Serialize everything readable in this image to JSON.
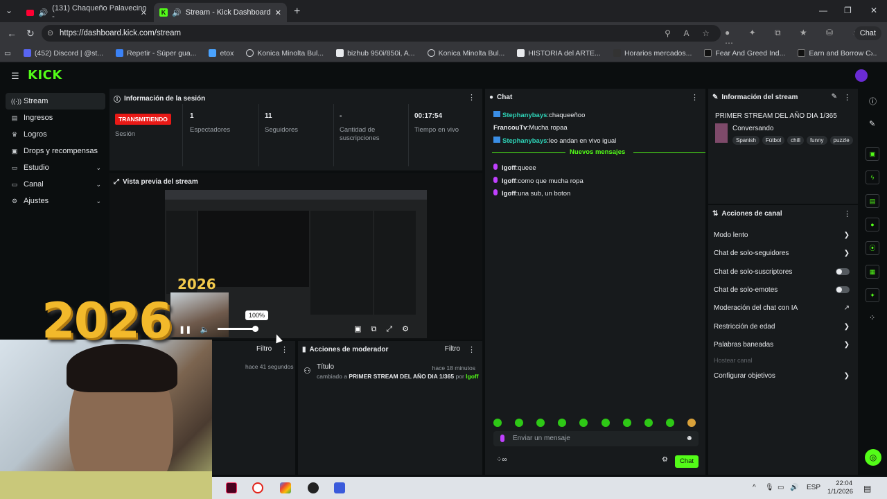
{
  "browser": {
    "tabs": [
      {
        "title": "(131) Chaqueño Palavecino -",
        "active": false
      },
      {
        "title": "Stream - Kick Dashboard",
        "active": true
      }
    ],
    "url": "https://dashboard.kick.com/stream",
    "chat_button": "Chat",
    "bookmarks": [
      "(452) Discord | @st...",
      "Repetir - Súper gua...",
      "etox",
      "Konica Minolta Bul...",
      "bizhub 950i/850i, A...",
      "Konica Minolta Bul...",
      "HISTORIA del ARTE...",
      "Horarios mercados...",
      "Fear And Greed Ind...",
      "Earn and Borrow C..."
    ]
  },
  "app": {
    "logo": "KICK",
    "sidebar": [
      {
        "label": "Stream",
        "icon": "broadcast-icon",
        "active": true,
        "chevron": false
      },
      {
        "label": "Ingresos",
        "icon": "money-icon",
        "active": false,
        "chevron": false
      },
      {
        "label": "Logros",
        "icon": "trophy-icon",
        "active": false,
        "chevron": false
      },
      {
        "label": "Drops y recompensas",
        "icon": "gift-icon",
        "active": false,
        "chevron": false
      },
      {
        "label": "Estudio",
        "icon": "studio-icon",
        "active": false,
        "chevron": true
      },
      {
        "label": "Canal",
        "icon": "channel-icon",
        "active": false,
        "chevron": true
      },
      {
        "label": "Ajustes",
        "icon": "gear-icon",
        "active": false,
        "chevron": true
      }
    ],
    "session": {
      "title": "Información de la sesión",
      "live_badge": "TRANSMITIENDO",
      "session_label": "Sesión",
      "viewers_value": "1",
      "viewers_label": "Espectadores",
      "followers_value": "11",
      "followers_label": "Seguidores",
      "subs_value": "-",
      "subs_label": "Cantidad de suscripciones",
      "time_value": "00:17:54",
      "time_label": "Tiempo en vivo"
    },
    "preview": {
      "title": "Vista previa del stream",
      "year_text": "2026",
      "volume_tip": "100%"
    },
    "activity": {
      "filter": "Filtro",
      "time": "hace 41 segundos"
    },
    "modactions": {
      "title": "Acciones de moderador",
      "filter": "Filtro",
      "item_title": "Título",
      "item_time": "hace 18 minutos",
      "item_prefix": "cambiado a",
      "item_value": "PRIMER STREAM DEL AÑO DIA 1/365",
      "item_by": "por",
      "item_user": "lgoff"
    },
    "chat": {
      "title": "Chat",
      "messages_old": [
        {
          "user": "Stephanybays",
          "text": "chaqueeñoo",
          "color": "#2ed3b7"
        },
        {
          "user": "FrancouTv",
          "text": "Mucha ropaa",
          "color": "#e8eaed"
        },
        {
          "user": "Stephanybays",
          "text": "leo andan en vivo igual",
          "color": "#2ed3b7"
        }
      ],
      "new_messages_label": "Nuevos mensajes",
      "messages_new": [
        {
          "user": "lgoff",
          "text": "queee"
        },
        {
          "user": "lgoff",
          "text": "como que mucha ropa"
        },
        {
          "user": "lgoff",
          "text": "una sub, un boton"
        }
      ],
      "input_placeholder": "Enviar un mensaje",
      "send_label": "Chat",
      "infinity": "∞"
    },
    "stream_info": {
      "title": "Información del stream",
      "stream_title": "PRIMER STREAM DEL AÑO DIA 1/365",
      "category": "Conversando",
      "tags": [
        "Spanish",
        "Fútbol",
        "chill",
        "funny",
        "puzzle"
      ]
    },
    "channel_actions": {
      "title": "Acciones de canal",
      "items": [
        {
          "label": "Modo lento",
          "control": "arrow"
        },
        {
          "label": "Chat de solo-seguidores",
          "control": "arrow"
        },
        {
          "label": "Chat de solo-suscriptores",
          "control": "toggle"
        },
        {
          "label": "Chat de solo-emotes",
          "control": "toggle"
        },
        {
          "label": "Moderación del chat con IA",
          "control": "external"
        },
        {
          "label": "Restricción de edad",
          "control": "arrow"
        },
        {
          "label": "Palabras baneadas",
          "control": "arrow"
        },
        {
          "label": "Hostear canal",
          "control": "disabled"
        },
        {
          "label": "Configurar objetivos",
          "control": "arrow"
        }
      ]
    }
  },
  "overlay": {
    "year_text": "2026"
  },
  "taskbar": {
    "lang": "ESP",
    "time": "22:04",
    "date": "1/1/2026"
  },
  "colors": {
    "kick_green": "#53fc18",
    "live_red": "#e91916",
    "panel_bg": "#171a1c"
  }
}
